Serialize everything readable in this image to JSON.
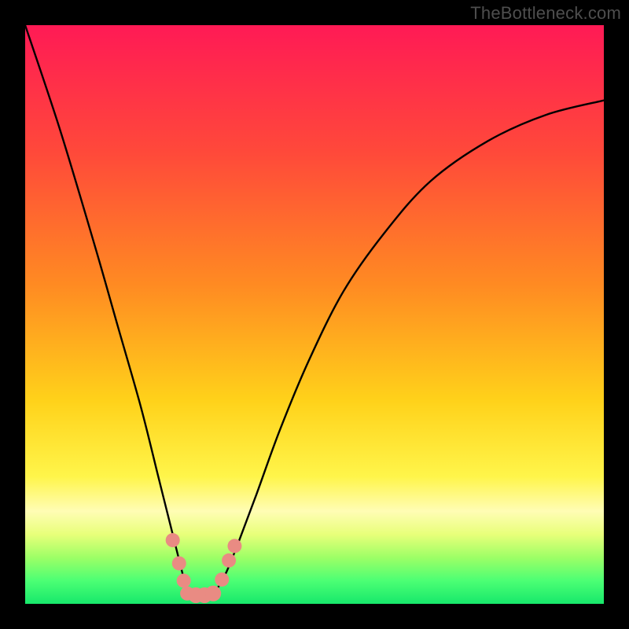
{
  "watermark": {
    "text": "TheBottleneck.com"
  },
  "chart_data": {
    "type": "line",
    "title": "",
    "xlabel": "",
    "ylabel": "",
    "xlim": [
      0,
      100
    ],
    "ylim": [
      0,
      100
    ],
    "grid": false,
    "legend": false,
    "background_gradient": {
      "stops": [
        {
          "offset": 0.0,
          "color": "#ff1a55"
        },
        {
          "offset": 0.22,
          "color": "#ff493a"
        },
        {
          "offset": 0.45,
          "color": "#ff8b22"
        },
        {
          "offset": 0.65,
          "color": "#ffd21a"
        },
        {
          "offset": 0.78,
          "color": "#fff54a"
        },
        {
          "offset": 0.84,
          "color": "#fffdb5"
        },
        {
          "offset": 0.88,
          "color": "#e8ff7a"
        },
        {
          "offset": 0.92,
          "color": "#9dff66"
        },
        {
          "offset": 0.96,
          "color": "#4cff74"
        },
        {
          "offset": 1.0,
          "color": "#17e86b"
        }
      ]
    },
    "series": [
      {
        "name": "curve",
        "color": "#000000",
        "x": [
          0,
          6,
          12,
          16,
          20,
          23,
          25,
          26.5,
          27.5,
          28,
          28.5,
          29.5,
          31,
          33,
          34,
          35,
          37,
          40,
          44,
          49,
          55,
          62,
          70,
          80,
          90,
          100
        ],
        "y": [
          100,
          82,
          62,
          48,
          34,
          22,
          14,
          8,
          4,
          2,
          1.5,
          1.5,
          1.5,
          2.5,
          4,
          6,
          11,
          19,
          30,
          42,
          54,
          64,
          73,
          80,
          84.5,
          87
        ]
      }
    ],
    "markers": {
      "color": "#e98b83",
      "points": [
        {
          "x": 25.5,
          "y": 11.0,
          "r": 9
        },
        {
          "x": 26.6,
          "y": 7.0,
          "r": 9
        },
        {
          "x": 27.4,
          "y": 4.0,
          "r": 9
        },
        {
          "x": 28.0,
          "y": 1.8,
          "r": 9
        },
        {
          "x": 29.5,
          "y": 1.5,
          "r": 10
        },
        {
          "x": 31.0,
          "y": 1.5,
          "r": 10
        },
        {
          "x": 32.5,
          "y": 1.8,
          "r": 10
        },
        {
          "x": 34.0,
          "y": 4.2,
          "r": 9
        },
        {
          "x": 35.2,
          "y": 7.5,
          "r": 9
        },
        {
          "x": 36.2,
          "y": 10.0,
          "r": 9
        }
      ]
    }
  }
}
